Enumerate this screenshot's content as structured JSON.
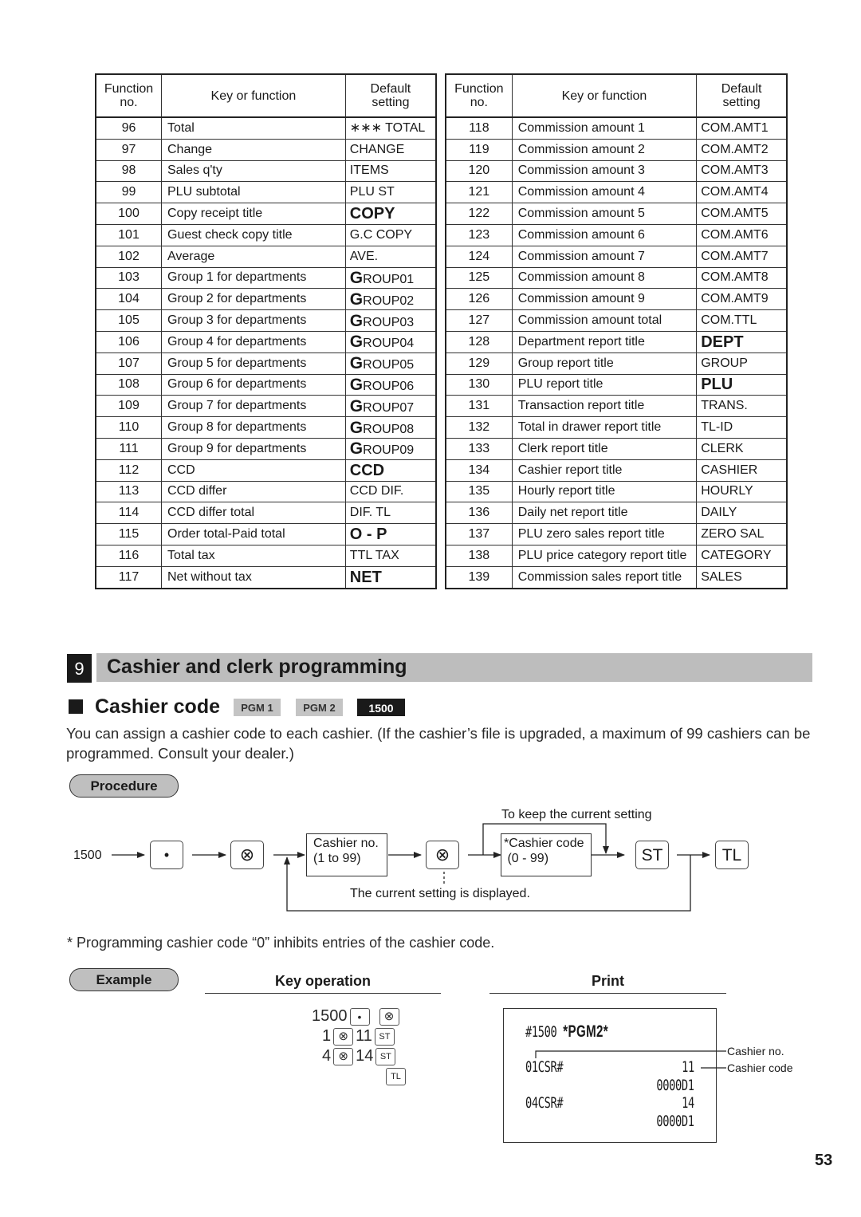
{
  "tables": {
    "headers": {
      "function_no": "Function no.",
      "function_no_l1": "Function",
      "function_no_l2": "no.",
      "key_or_function": "Key or function",
      "default_l1": "Default",
      "default_l2": "setting"
    },
    "left": [
      {
        "no": "96",
        "key": "Total",
        "default": "∗∗∗ TOTAL",
        "style": "normal"
      },
      {
        "no": "97",
        "key": "Change",
        "default": "CHANGE",
        "style": "normal"
      },
      {
        "no": "98",
        "key": "Sales q'ty",
        "default": "ITEMS",
        "style": "normal"
      },
      {
        "no": "99",
        "key": "PLU subtotal",
        "default": "PLU ST",
        "style": "normal"
      },
      {
        "no": "100",
        "key": "Copy receipt title",
        "default": "COPY",
        "style": "bold"
      },
      {
        "no": "101",
        "key": "Guest check copy title",
        "default": "G.C COPY",
        "style": "normal"
      },
      {
        "no": "102",
        "key": "Average",
        "default": "AVE.",
        "style": "normal"
      },
      {
        "no": "103",
        "key": "Group 1 for departments",
        "default": "GROUP01",
        "style": "bigG"
      },
      {
        "no": "104",
        "key": "Group 2 for departments",
        "default": "GROUP02",
        "style": "bigG"
      },
      {
        "no": "105",
        "key": "Group 3 for departments",
        "default": "GROUP03",
        "style": "bigG"
      },
      {
        "no": "106",
        "key": "Group 4 for departments",
        "default": "GROUP04",
        "style": "bigG"
      },
      {
        "no": "107",
        "key": "Group 5 for departments",
        "default": "GROUP05",
        "style": "bigG"
      },
      {
        "no": "108",
        "key": "Group 6 for departments",
        "default": "GROUP06",
        "style": "bigG"
      },
      {
        "no": "109",
        "key": "Group 7 for departments",
        "default": "GROUP07",
        "style": "bigG"
      },
      {
        "no": "110",
        "key": "Group 8 for departments",
        "default": "GROUP08",
        "style": "bigG"
      },
      {
        "no": "111",
        "key": "Group 9 for departments",
        "default": "GROUP09",
        "style": "bigG"
      },
      {
        "no": "112",
        "key": "CCD",
        "default": "CCD",
        "style": "bold"
      },
      {
        "no": "113",
        "key": "CCD differ",
        "default": "CCD DIF.",
        "style": "normal"
      },
      {
        "no": "114",
        "key": "CCD differ total",
        "default": "DIF. TL",
        "style": "normal"
      },
      {
        "no": "115",
        "key": "Order total-Paid total",
        "default": "O - P",
        "style": "bold"
      },
      {
        "no": "116",
        "key": "Total tax",
        "default": "TTL TAX",
        "style": "normal"
      },
      {
        "no": "117",
        "key": "Net without tax",
        "default": "NET",
        "style": "bold"
      }
    ],
    "right": [
      {
        "no": "118",
        "key": "Commission amount 1",
        "default": "COM.AMT1",
        "style": "normal"
      },
      {
        "no": "119",
        "key": "Commission amount 2",
        "default": "COM.AMT2",
        "style": "normal"
      },
      {
        "no": "120",
        "key": "Commission amount 3",
        "default": "COM.AMT3",
        "style": "normal"
      },
      {
        "no": "121",
        "key": "Commission amount 4",
        "default": "COM.AMT4",
        "style": "normal"
      },
      {
        "no": "122",
        "key": "Commission amount 5",
        "default": "COM.AMT5",
        "style": "normal"
      },
      {
        "no": "123",
        "key": "Commission amount 6",
        "default": "COM.AMT6",
        "style": "normal"
      },
      {
        "no": "124",
        "key": "Commission amount 7",
        "default": "COM.AMT7",
        "style": "normal"
      },
      {
        "no": "125",
        "key": "Commission amount 8",
        "default": "COM.AMT8",
        "style": "normal"
      },
      {
        "no": "126",
        "key": "Commission amount 9",
        "default": "COM.AMT9",
        "style": "normal"
      },
      {
        "no": "127",
        "key": "Commission amount total",
        "default": "COM.TTL",
        "style": "normal"
      },
      {
        "no": "128",
        "key": "Department report title",
        "default": "DEPT",
        "style": "bold"
      },
      {
        "no": "129",
        "key": "Group report title",
        "default": "GROUP",
        "style": "normal"
      },
      {
        "no": "130",
        "key": "PLU report title",
        "default": "PLU",
        "style": "bold"
      },
      {
        "no": "131",
        "key": "Transaction report title",
        "default": "TRANS.",
        "style": "normal"
      },
      {
        "no": "132",
        "key": "Total in drawer report title",
        "default": "TL-ID",
        "style": "normal"
      },
      {
        "no": "133",
        "key": "Clerk report title",
        "default": "CLERK",
        "style": "normal"
      },
      {
        "no": "134",
        "key": "Cashier report title",
        "default": "CASHIER",
        "style": "normal"
      },
      {
        "no": "135",
        "key": "Hourly report title",
        "default": "HOURLY",
        "style": "normal"
      },
      {
        "no": "136",
        "key": "Daily net report title",
        "default": "DAILY",
        "style": "normal"
      },
      {
        "no": "137",
        "key": "PLU zero sales report title",
        "default": "ZERO SAL",
        "style": "normal"
      },
      {
        "no": "138",
        "key": "PLU price category report title",
        "default": "CATEGORY",
        "style": "normal"
      },
      {
        "no": "139",
        "key": "Commission sales report title",
        "default": "SALES",
        "style": "normal"
      }
    ]
  },
  "section": {
    "number": "9",
    "title": "Cashier and clerk programming"
  },
  "subsection": {
    "title": "Cashier code",
    "modes": [
      "PGM 1",
      "PGM 2",
      "1500"
    ],
    "description": "You can assign a cashier code to each cashier.  (If the cashier’s file is upgraded, a maximum of 99 cashiers can be programmed.  Consult your dealer.)"
  },
  "procedure": {
    "label": "Procedure",
    "start": "1500",
    "key_dot": "•",
    "key_x": "⊗",
    "box1_l1": "Cashier no.",
    "box1_l2": "(1 to 99)",
    "box2_l1": "*Cashier code",
    "box2_l2": " (0 - 99)",
    "keep_note": "To keep the current setting",
    "display_note": "The current setting is displayed.",
    "key_st": "ST",
    "key_tl": "TL"
  },
  "footnote": "* Programming cashier code “0” inhibits entries of the cashier code.",
  "example": {
    "label": "Example",
    "key_operation_heading": "Key operation",
    "print_heading": "Print",
    "key_operation": {
      "line1_num": "1500",
      "line2_a": "1",
      "line2_b": "11",
      "line3_a": "4",
      "line3_b": "14",
      "st": "ST",
      "tl": "TL",
      "dot": "•",
      "x": "⊗"
    },
    "receipt": {
      "header_prefix": "#1500 ",
      "header_mode": "*PGM2*",
      "row1_label": "01CSR#",
      "row1_code": "11",
      "row1_id": "0000D1",
      "row2_label": "04CSR#",
      "row2_code": "14",
      "row2_id": "0000D1"
    },
    "annotations": {
      "cashier_no": "Cashier no.",
      "cashier_code": "Cashier code"
    }
  },
  "page_number": "53"
}
